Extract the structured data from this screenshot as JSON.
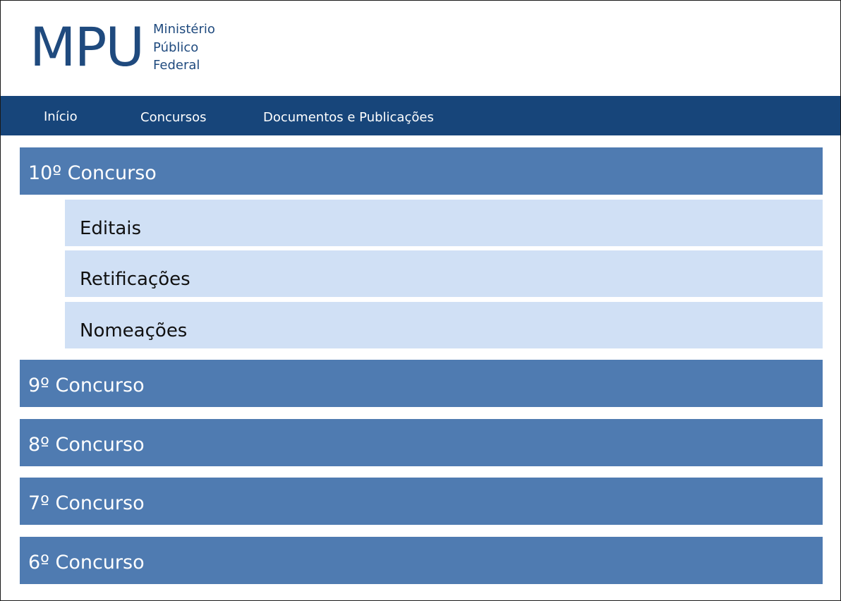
{
  "header": {
    "logo_mark": "MPU",
    "logo_sub": [
      "Ministério",
      "Público",
      "Federal"
    ]
  },
  "nav": {
    "items": [
      {
        "label": "Início"
      },
      {
        "label": "Concursos"
      },
      {
        "label": "Documentos e Publicações"
      }
    ]
  },
  "contests": [
    {
      "label": "10º Concurso",
      "expanded": true,
      "children": [
        {
          "label": "Editais"
        },
        {
          "label": "Retificações"
        },
        {
          "label": "Nomeações"
        }
      ]
    },
    {
      "label": "9º Concurso",
      "expanded": false
    },
    {
      "label": "8º Concurso",
      "expanded": false
    },
    {
      "label": "7º Concurso",
      "expanded": false
    },
    {
      "label": "6º Concurso",
      "expanded": false
    }
  ],
  "colors": {
    "nav_bg": "#17457a",
    "brand": "#1f4a7e",
    "contest_bg": "#4f7bb1",
    "sub_bg": "#d0e0f5"
  }
}
